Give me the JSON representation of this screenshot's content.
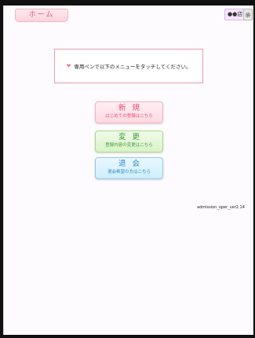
{
  "header": {
    "home_label": "ホーム",
    "store_label": "●●店"
  },
  "instruction": {
    "text": "専用ペンで以下のメニューをタッチしてください。"
  },
  "menu": {
    "new": {
      "title": "新規",
      "subtitle": "はじめての登録はこちら"
    },
    "change": {
      "title": "変更",
      "subtitle": "登録内容の変更はこちら"
    },
    "withdraw": {
      "title": "退会",
      "subtitle": "退会希望の方はこちら"
    }
  },
  "footer": {
    "version": "admission_oper_ver2.14"
  },
  "colors": {
    "pink": "#e0507a",
    "green": "#3e9e3a",
    "blue": "#2a88c0"
  },
  "icons": {
    "settings": "gear-icon",
    "heart": "heart-icon"
  }
}
